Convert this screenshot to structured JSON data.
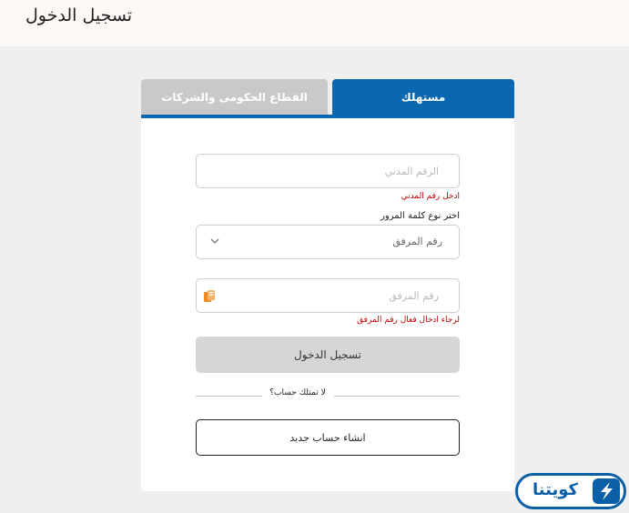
{
  "header": {
    "title": "تسجيل الدخول"
  },
  "tabs": [
    {
      "label": "مستهلك",
      "active": true
    },
    {
      "label": "القطاع الحكومى والشركات",
      "active": false
    }
  ],
  "form": {
    "civil_id": {
      "placeholder": "الرقم المدني",
      "error": "ادخل رقم المدني"
    },
    "password_type": {
      "label": "اختر نوع كلمة المرور",
      "selected": "رقم المرفق"
    },
    "attachment": {
      "placeholder": "رقم المرفق",
      "error": "لرجاء ادخال فعال رقم المرفق"
    },
    "login_label": "تسجيل الدخول",
    "no_account": "لا تمتلك حساب؟",
    "create_label": "انشاء حساب جديد"
  },
  "logo": {
    "text": "كويتنا"
  },
  "colors": {
    "accent": "#0a67b1",
    "error": "#c00000",
    "inactive_tab": "#c9c9c9"
  },
  "icons": {
    "select": "chevron-down-icon",
    "attachment": "attachment-icon"
  }
}
